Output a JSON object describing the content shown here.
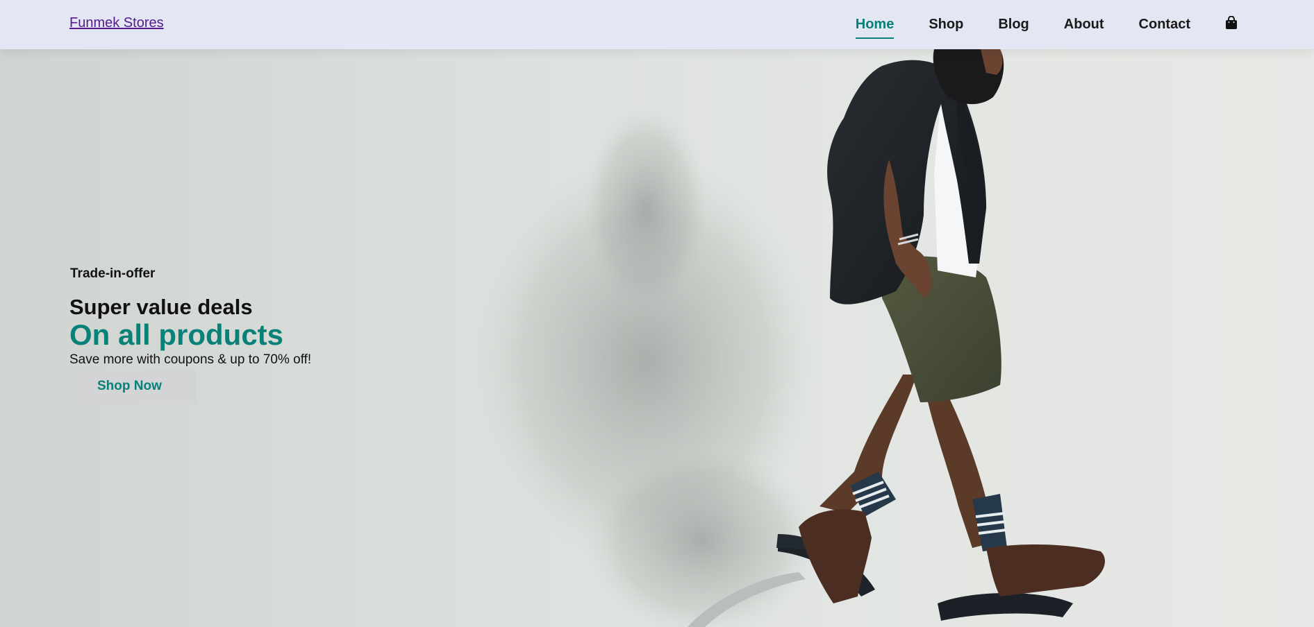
{
  "header": {
    "logo": "Funmek Stores",
    "nav": [
      {
        "label": "Home",
        "active": true
      },
      {
        "label": "Shop"
      },
      {
        "label": "Blog"
      },
      {
        "label": "About"
      },
      {
        "label": "Contact"
      }
    ],
    "cart_icon": "shopping-bag-icon"
  },
  "hero": {
    "kicker": "Trade-in-offer",
    "heading": "Super value deals",
    "title": "On all products",
    "subtitle": "Save more with coupons & up to 70% off!",
    "button": "Shop Now"
  },
  "colors": {
    "accent": "#088178",
    "header_bg": "#e3e6f3",
    "button_bg": "#d2d4d6"
  }
}
